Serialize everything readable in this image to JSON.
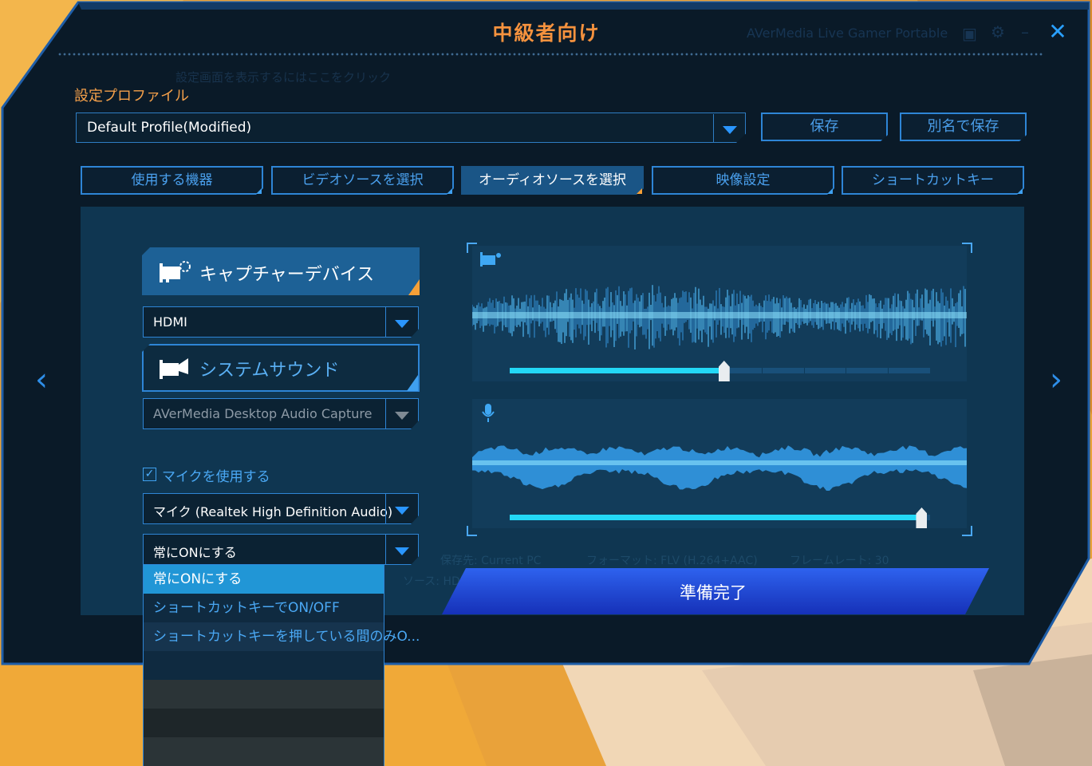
{
  "window": {
    "title": "中級者向け",
    "close_glyph": "✕"
  },
  "background_header": {
    "app_name": "AVerMedia Live Gamer Portable",
    "faint_subtitle": "設定画面を表示するにはここをクリック"
  },
  "profile": {
    "label": "設定プロファイル",
    "value": "Default Profile(Modified)",
    "save_label": "保存",
    "save_as_label": "別名で保存"
  },
  "tabs": [
    {
      "label": "使用する機器",
      "active": false
    },
    {
      "label": "ビデオソースを選択",
      "active": false
    },
    {
      "label": "オーディオソースを選択",
      "active": true
    },
    {
      "label": "映像設定",
      "active": false
    },
    {
      "label": "ショートカットキー",
      "active": false
    }
  ],
  "audio": {
    "capture_device_label": "キャプチャーデバイス",
    "capture_source": "HDMI",
    "system_sound_label": "システムサウンド",
    "system_sound_device": "AVerMedia Desktop Audio Capture",
    "use_mic_label": "マイクを使用する",
    "use_mic_checked": true,
    "mic_device": "マイク (Realtek High Definition Audio)",
    "mic_mode_selected": "常にONにする",
    "mic_mode_options": [
      "常にONにする",
      "ショートカットキーでON/OFF",
      "ショートカットキーを押している間のみO..."
    ],
    "capture_volume_fraction": 0.51,
    "mic_volume_fraction": 0.98
  },
  "background_panel": {
    "storage_label": "保存先: Current PC",
    "format_label": "フォーマット: FLV (H.264+AAC)",
    "fps_label": "フレームレート: 30",
    "source_label": "ソース: HDMI"
  },
  "ready_button": "準備完了",
  "colors": {
    "accent_orange": "#f5923e",
    "accent_blue": "#2e85d6",
    "wave_cyan": "#23d8f6",
    "ready_blue": "#2443d6"
  },
  "icons": [
    "close-icon",
    "dropdown-arrow-icon",
    "capture-card-icon",
    "speaker-icon",
    "microphone-icon",
    "camera-icon",
    "chevron-left-icon",
    "chevron-right-icon",
    "checkbox-icon"
  ]
}
